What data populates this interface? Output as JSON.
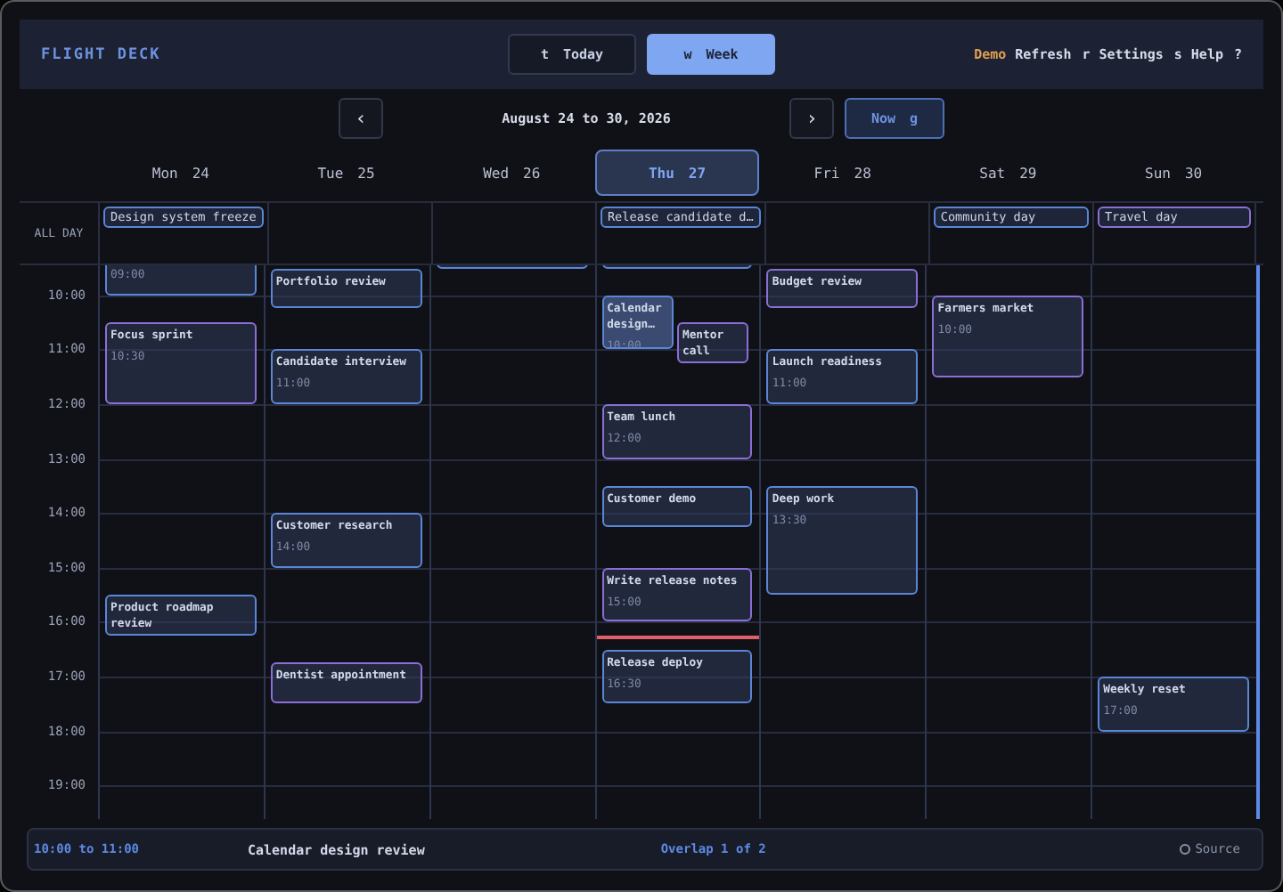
{
  "header": {
    "brand": "FLIGHT DECK",
    "tabs": [
      {
        "key": "t",
        "label": "Today",
        "selected": false
      },
      {
        "key": "w",
        "label": "Week",
        "selected": true
      }
    ],
    "mode": "Demo",
    "links": [
      {
        "label": "Refresh",
        "key": "r"
      },
      {
        "label": "Settings",
        "key": "s"
      },
      {
        "label": "Help",
        "key": "?"
      }
    ]
  },
  "nav": {
    "prev": "‹",
    "range": "August 24 to 30, 2026",
    "next": "›",
    "now_button": {
      "label": "Now",
      "key": "g"
    }
  },
  "all_day_label": "ALL DAY",
  "hours": [
    "10:00",
    "11:00",
    "12:00",
    "13:00",
    "14:00",
    "15:00",
    "16:00",
    "17:00",
    "18:00",
    "19:00"
  ],
  "days": [
    {
      "name": "Mon",
      "date": "24",
      "selected": false,
      "all_day": [
        {
          "title": "Design system freeze",
          "color": "#5a86d8"
        }
      ],
      "events": [
        {
          "time": "09:00",
          "color": "#5a86d8",
          "selected": false
        },
        {
          "title": "Focus sprint",
          "time": "10:30",
          "color": "#8b6fd6",
          "selected": false
        },
        {
          "title": "Product roadmap review",
          "color": "#5a86d8",
          "selected": false
        }
      ]
    },
    {
      "name": "Tue",
      "date": "25",
      "selected": false,
      "events": [
        {
          "title": "Portfolio review",
          "color": "#5a86d8",
          "selected": false
        },
        {
          "title": "Candidate interview",
          "time": "11:00",
          "color": "#5a86d8",
          "selected": false
        },
        {
          "title": "Customer research",
          "time": "14:00",
          "color": "#5a86d8",
          "selected": false
        },
        {
          "title": "Dentist appointment",
          "color": "#8b6fd6",
          "selected": false
        }
      ]
    },
    {
      "name": "Wed",
      "date": "26",
      "selected": false,
      "events": [
        {
          "color": "#5a86d8",
          "selected": false
        }
      ]
    },
    {
      "name": "Thu",
      "date": "27",
      "selected": true,
      "all_day": [
        {
          "title": "Release candidate d…",
          "color": "#5a86d8"
        }
      ],
      "events": [
        {
          "color": "#5a86d8",
          "selected": false
        },
        {
          "title": "Calendar design…",
          "time": "10:00",
          "color": "#5a86d8",
          "selected": true
        },
        {
          "title": "Mentor call",
          "color": "#8b6fd6",
          "selected": false
        },
        {
          "title": "Team lunch",
          "time": "12:00",
          "color": "#8b6fd6",
          "selected": false
        },
        {
          "title": "Customer demo",
          "color": "#5a86d8",
          "selected": false
        },
        {
          "title": "Write release notes",
          "time": "15:00",
          "color": "#8b6fd6",
          "selected": false
        },
        {
          "title": "Release deploy",
          "time": "16:30",
          "color": "#5a86d8",
          "selected": false
        }
      ]
    },
    {
      "name": "Fri",
      "date": "28",
      "selected": false,
      "events": [
        {
          "title": "Budget review",
          "color": "#8b6fd6",
          "selected": false
        },
        {
          "title": "Launch readiness",
          "time": "11:00",
          "color": "#5a86d8",
          "selected": false
        },
        {
          "title": "Deep work",
          "time": "13:30",
          "color": "#5a86d8",
          "selected": false
        }
      ]
    },
    {
      "name": "Sat",
      "date": "29",
      "selected": false,
      "all_day": [
        {
          "title": "Community day",
          "color": "#5a86d8"
        }
      ],
      "events": [
        {
          "title": "Farmers market",
          "time": "10:00",
          "color": "#8b6fd6",
          "selected": false
        }
      ]
    },
    {
      "name": "Sun",
      "date": "30",
      "selected": false,
      "all_day": [
        {
          "title": "Travel day",
          "color": "#8b6fd6"
        }
      ],
      "events": [
        {
          "title": "Weekly reset",
          "time": "17:00",
          "color": "#5a86d8",
          "selected": false
        }
      ]
    }
  ],
  "status_bar": {
    "time_range": "10:00 to 11:00",
    "title": "Calendar design review",
    "overlap": "Overlap 1 of 2",
    "source": "Source"
  }
}
